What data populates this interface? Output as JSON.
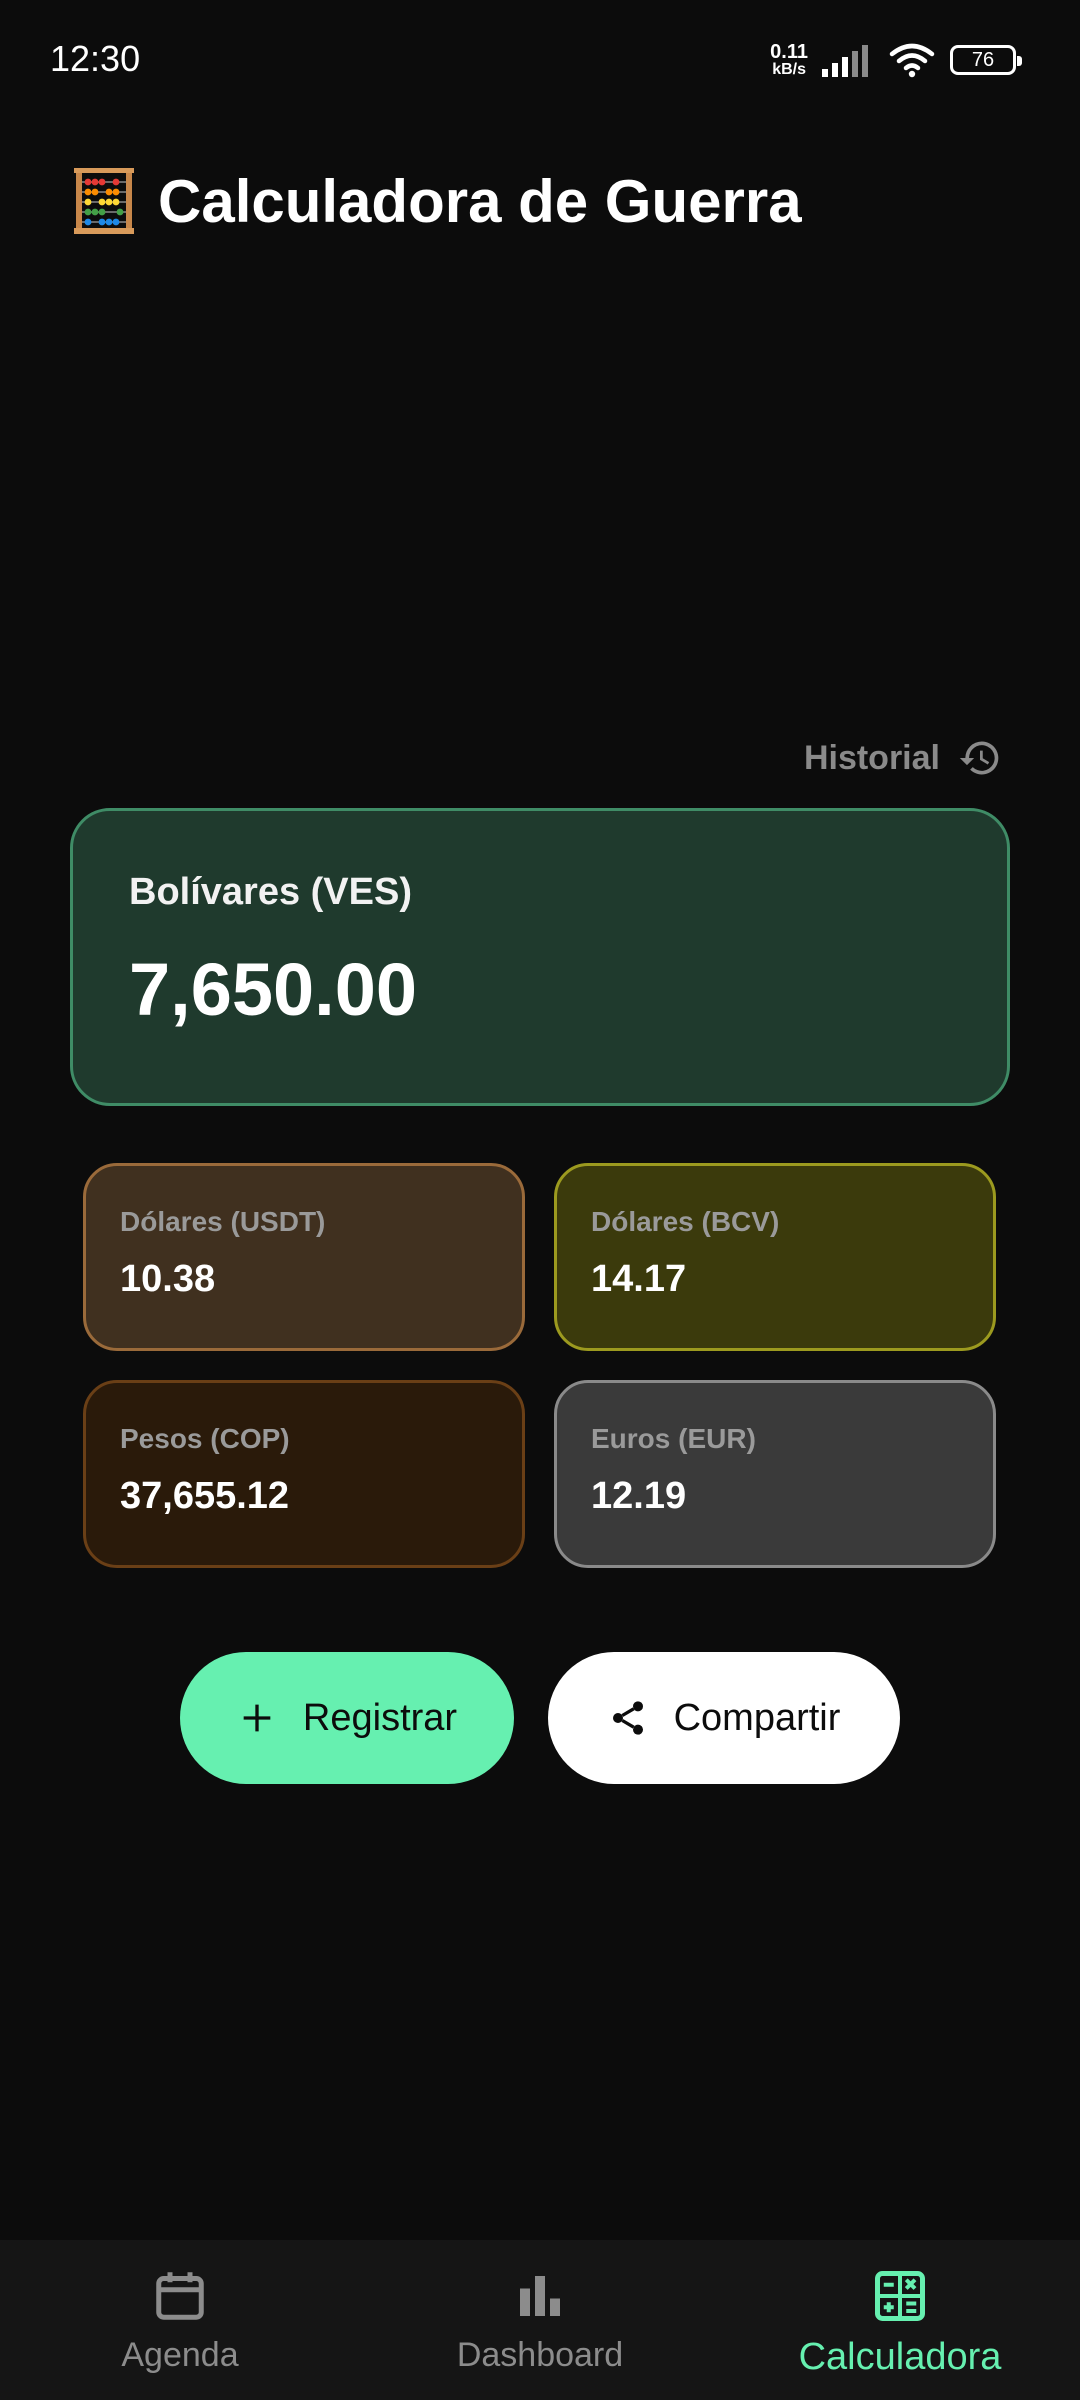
{
  "status_bar": {
    "time": "12:30",
    "net_speed_value": "0.11",
    "net_speed_unit": "kB/s",
    "battery_level": "76"
  },
  "header": {
    "title": "Calculadora de Guerra",
    "icon": "abacus-icon"
  },
  "history": {
    "label": "Historial",
    "icon": "history-icon"
  },
  "main_currency": {
    "label": "Bolívares (VES)",
    "value": "7,650.00"
  },
  "conversions": [
    {
      "label": "Dólares (USDT)",
      "value": "10.38"
    },
    {
      "label": "Dólares (BCV)",
      "value": "14.17"
    },
    {
      "label": "Pesos (COP)",
      "value": "37,655.12"
    },
    {
      "label": "Euros (EUR)",
      "value": "12.19"
    }
  ],
  "actions": {
    "register_label": "Registrar",
    "share_label": "Compartir"
  },
  "bottom_nav": {
    "items": [
      {
        "label": "Agenda",
        "icon": "calendar-icon",
        "active": false
      },
      {
        "label": "Dashboard",
        "icon": "bar-chart-icon",
        "active": false
      },
      {
        "label": "Calculadora",
        "icon": "calculator-icon",
        "active": true
      }
    ]
  },
  "colors": {
    "accent": "#66f0b0",
    "background": "#0c0c0c",
    "main_card_bg": "#1f3a2d"
  }
}
